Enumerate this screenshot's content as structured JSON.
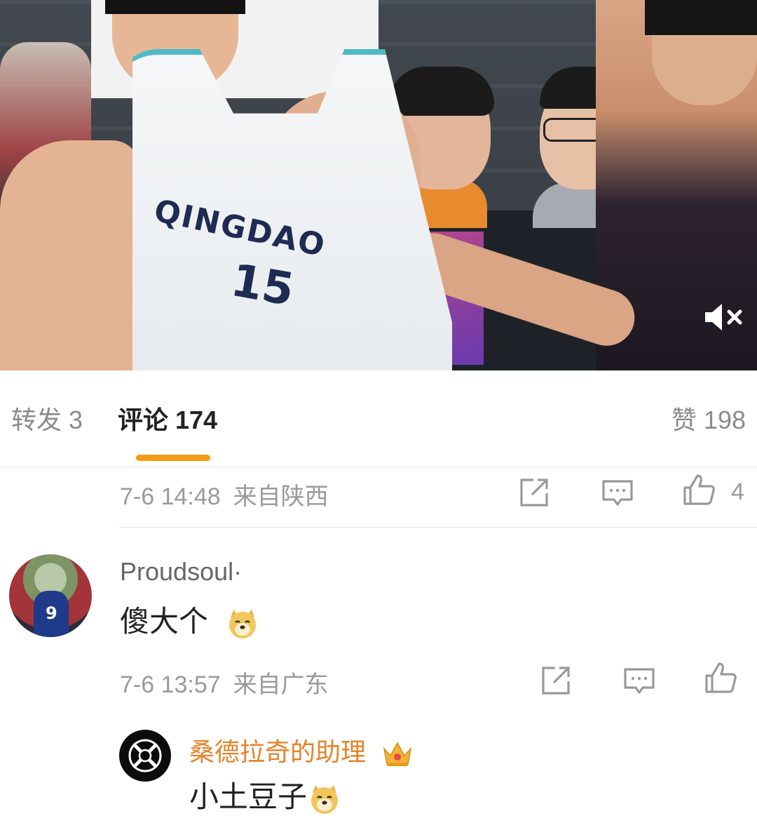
{
  "video": {
    "jersey_text": "QINGDAO",
    "jersey_number": "15",
    "mute_icon": "speaker-muted-icon"
  },
  "tabs": {
    "repost": {
      "label": "转发",
      "count": "3"
    },
    "comments": {
      "label": "评论",
      "count": "174"
    },
    "likes": {
      "label": "赞",
      "count": "198"
    },
    "active": "comments",
    "accent_color": "#f59a14"
  },
  "comments": [
    {
      "time": "7-6 14:48",
      "location": "来自陕西",
      "like_count": "4",
      "icons": [
        "share-icon",
        "comment-icon",
        "like-icon"
      ]
    },
    {
      "username": "Proudsoul·",
      "text": "傻大个",
      "emoji": "doge-emoji-icon",
      "time": "7-6 13:57",
      "location": "来自广东",
      "icons": [
        "share-icon",
        "comment-icon",
        "like-icon"
      ]
    },
    {
      "username": "桑德拉奇的助理",
      "badge": "crown-badge-icon",
      "username_color": "#e5832a",
      "text": "小土豆子",
      "emoji": "doge-emoji-icon"
    }
  ]
}
